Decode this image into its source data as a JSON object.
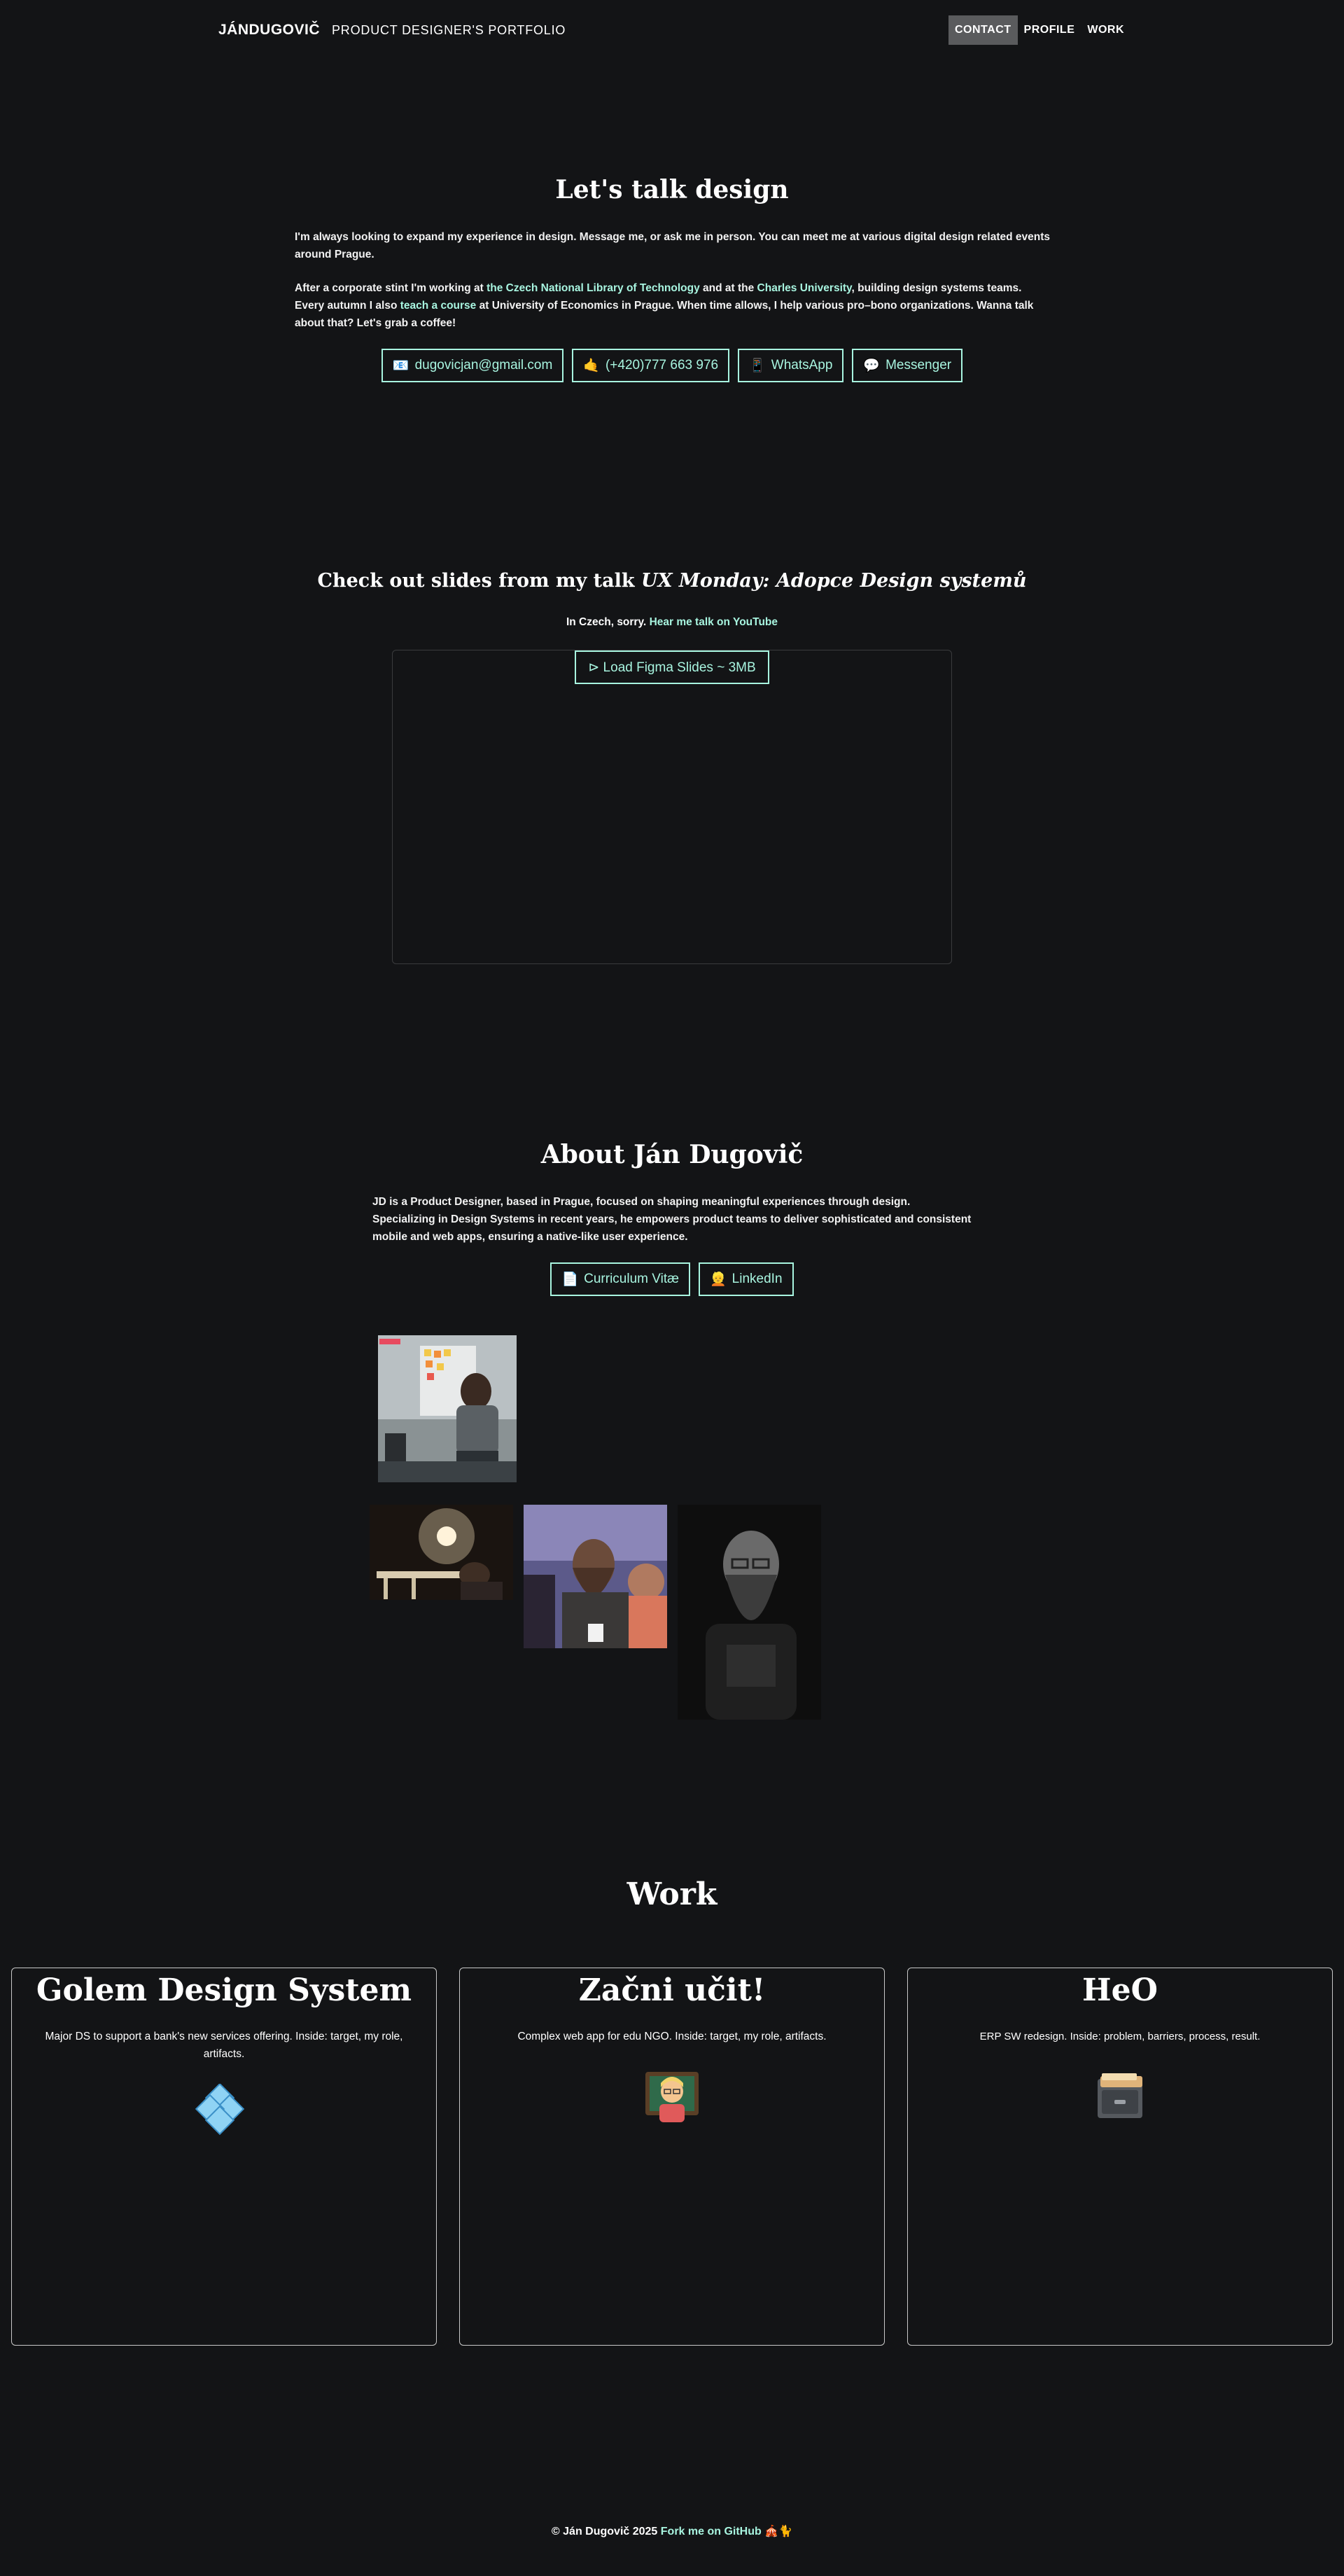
{
  "nav": {
    "brand": "JÁNDUGOVIČ",
    "subtitle": "PRODUCT DESIGNER'S PORTFOLIO",
    "links": [
      "CONTACT",
      "PROFILE",
      "WORK"
    ],
    "active": "CONTACT"
  },
  "contact": {
    "title": "Let's talk design",
    "p1": "I'm always looking to expand my experience in design. Message me, or ask me in person. You can meet me at various digital design related events around Prague.",
    "p2_a": "After a corporate stint I'm working at ",
    "p2_link1": "the Czech National Library of Technology",
    "p2_b": " and at the ",
    "p2_link2": "Charles University",
    "p2_c": ", building design systems teams. Every autumn I also ",
    "p2_link3": "teach a course",
    "p2_d": " at University of Economics in Prague. When time allows, I help various pro–bono organizations.    Wanna talk about that? Let's grab a coffee!",
    "buttons": [
      {
        "icon": "📧",
        "label": "dugovicjan@gmail.com"
      },
      {
        "icon": "🤙",
        "label": "(+420)777 663 976"
      },
      {
        "icon": "📱",
        "label": "WhatsApp"
      },
      {
        "icon": "💬",
        "label": "Messenger"
      }
    ]
  },
  "slides": {
    "title_a": "Check out slides from my talk ",
    "title_em": "UX Monday: Adopce Design systemů",
    "note": "In Czech, sorry. ",
    "note_link": "Hear me talk on YouTube",
    "load_button": "⊳ Load Figma Slides ~ 3MB"
  },
  "about": {
    "title": "About Ján Dugovič",
    "text": "JD is a Product Designer, based in Prague, focused on shaping meaningful experiences through design. Specializing in Design Systems in recent years, he empowers product teams to deliver sophisticated and consistent mobile and web apps, ensuring a native-like user experience.",
    "buttons": [
      {
        "icon": "📄",
        "label": "Curriculum Vitæ"
      },
      {
        "icon": "👱",
        "label": "LinkedIn"
      }
    ]
  },
  "work": {
    "title": "Work",
    "cards": [
      {
        "title": "Golem Design System",
        "desc": "Major DS to support a bank's new services offering. Inside: target, my role, artifacts.",
        "icon": "diamond-tiles-icon"
      },
      {
        "title": "Začni učit!",
        "desc": "Complex web app for edu NGO. Inside: target, my role, artifacts.",
        "icon": "teacher-icon"
      },
      {
        "title": "HeO",
        "desc": "ERP SW redesign. Inside: problem, barriers, process, result.",
        "icon": "file-cabinet-icon"
      }
    ]
  },
  "footer": {
    "text": "© Ján Dugovič 2025 ",
    "link": "Fork me on GitHub",
    "emoji": "🎪🐈"
  },
  "colors": {
    "background": "#131416",
    "accent": "#a8f5e0",
    "active_nav": "#5a5b5d"
  }
}
